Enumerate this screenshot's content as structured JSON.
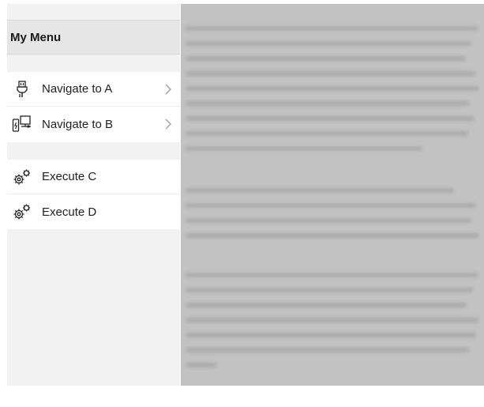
{
  "menu": {
    "title": "My Menu",
    "items": [
      {
        "label": "Navigate to A",
        "icon": "plug-icon",
        "chevron": "›"
      },
      {
        "label": "Navigate to B",
        "icon": "device-network-icon",
        "chevron": "›"
      },
      {
        "label": "Execute C",
        "icon": "gears-icon"
      },
      {
        "label": "Execute D",
        "icon": "gears-icon"
      }
    ]
  }
}
